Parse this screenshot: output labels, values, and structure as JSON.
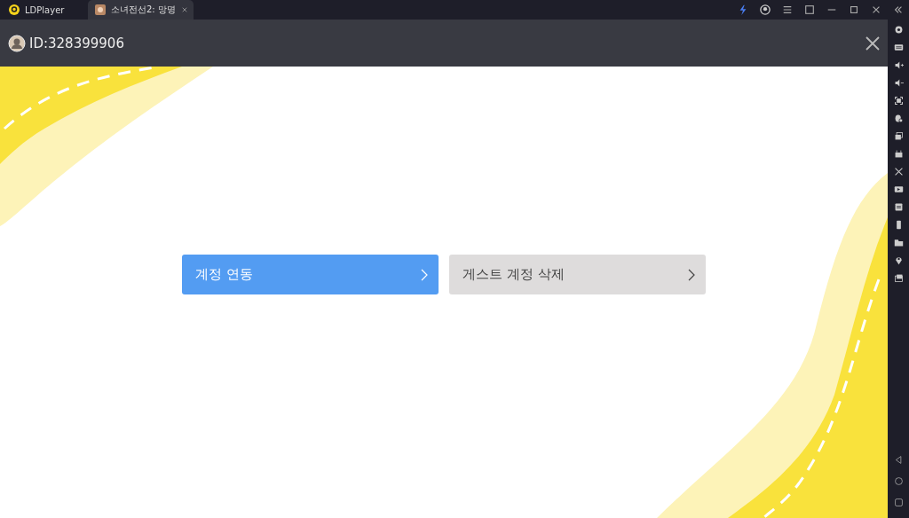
{
  "tabs": [
    {
      "label": "LDPlayer",
      "selected": false,
      "kind": "home"
    },
    {
      "label": "소녀전선2: 망명",
      "selected": true,
      "kind": "game"
    }
  ],
  "header": {
    "account_id": "ID:328399906"
  },
  "buttons": [
    {
      "label": "계정 연동",
      "kind": "primary"
    },
    {
      "label": "게스트 계정 삭제",
      "kind": "secondary"
    }
  ]
}
